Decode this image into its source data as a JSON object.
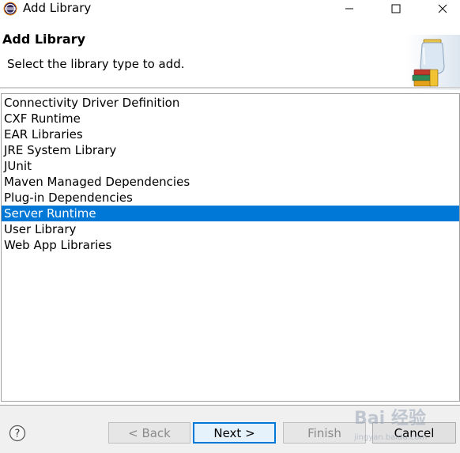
{
  "window": {
    "title": "Add Library",
    "app_icon": "eclipse-icon",
    "controls": {
      "minimize_icon": "minimize-icon",
      "maximize_icon": "maximize-icon",
      "close_icon": "close-icon"
    }
  },
  "header": {
    "title": "Add Library",
    "description": "Select the library type to add.",
    "graphic_icon": "library-jar-icon"
  },
  "library_list": {
    "items": [
      {
        "label": "Connectivity Driver Definition",
        "selected": false
      },
      {
        "label": "CXF Runtime",
        "selected": false
      },
      {
        "label": "EAR Libraries",
        "selected": false
      },
      {
        "label": "JRE System Library",
        "selected": false
      },
      {
        "label": "JUnit",
        "selected": false
      },
      {
        "label": "Maven Managed Dependencies",
        "selected": false
      },
      {
        "label": "Plug-in Dependencies",
        "selected": false
      },
      {
        "label": "Server Runtime",
        "selected": true
      },
      {
        "label": "User Library",
        "selected": false
      },
      {
        "label": "Web App Libraries",
        "selected": false
      }
    ],
    "selection_color": "#0078d7"
  },
  "footer": {
    "help_icon": "help-icon",
    "back_label": "< Back",
    "next_label": "Next >",
    "finish_label": "Finish",
    "cancel_label": "Cancel"
  },
  "watermark": {
    "text": "Bai 经验",
    "subtext": "jingyan.baidu.com"
  }
}
